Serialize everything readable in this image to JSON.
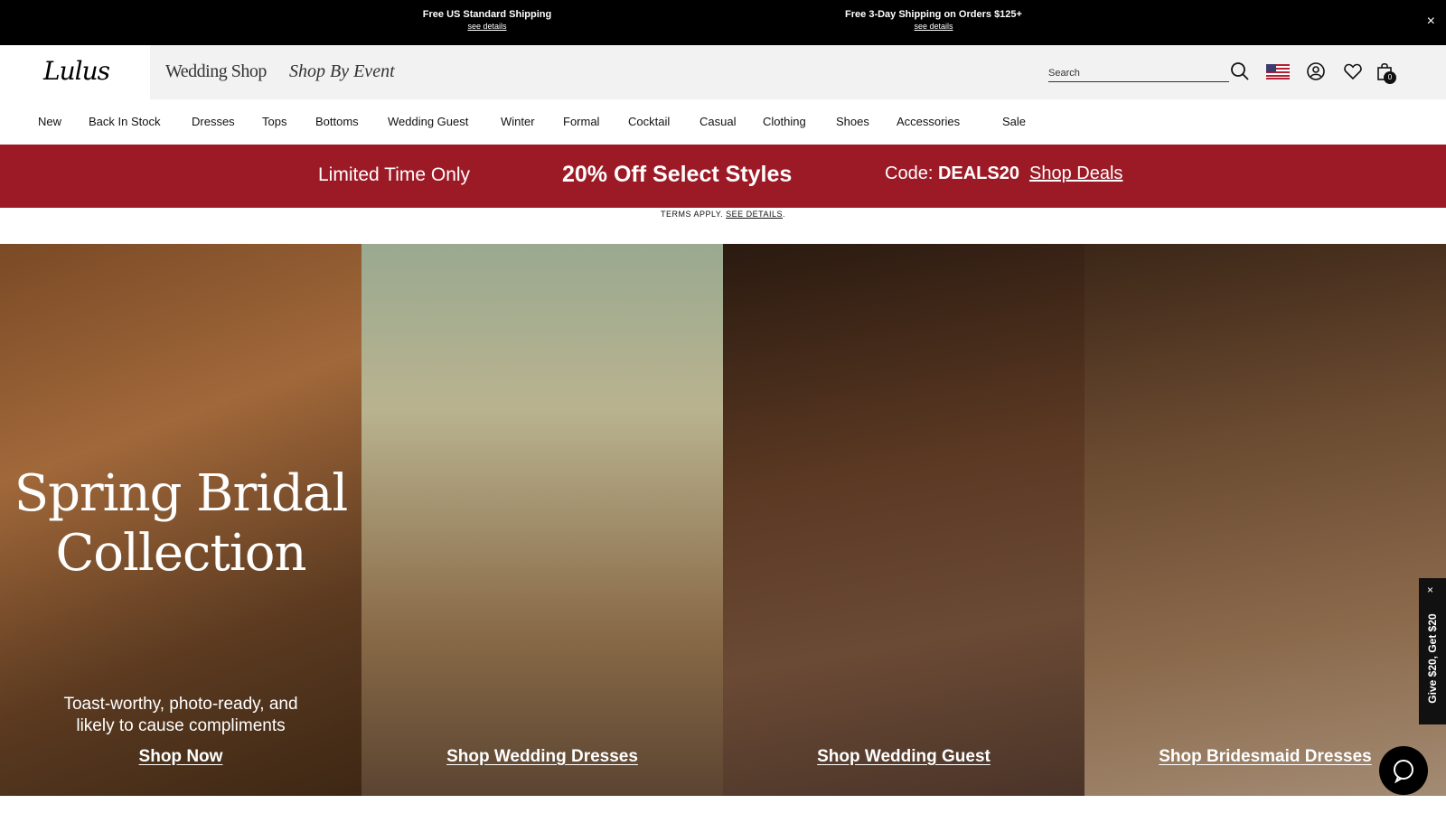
{
  "topbar": {
    "left_title": "Free US Standard Shipping",
    "left_details": "see details",
    "right_title": "Free 3-Day Shipping on Orders $125+",
    "right_details": "see details",
    "close": "×"
  },
  "header": {
    "logo": "Lulus",
    "wedding_shop": "Wedding Shop",
    "shop_by_event": "Shop By Event",
    "search_placeholder": "Search",
    "cart_count": "0"
  },
  "nav": {
    "items": [
      "New",
      "Back In Stock",
      "Dresses",
      "Tops",
      "Bottoms",
      "Wedding Guest",
      "Winter",
      "Formal",
      "Cocktail",
      "Casual",
      "Clothing",
      "Shoes",
      "Accessories",
      "Sale"
    ]
  },
  "promo": {
    "limited": "Limited Time Only",
    "offer": "20% Off Select Styles",
    "code_label": "Code: ",
    "code": "DEALS20",
    "shop_deals": "Shop Deals",
    "terms": "TERMS APPLY.",
    "see_details": "SEE DETAILS"
  },
  "hero": {
    "panel1_heading_line1": "Spring Bridal",
    "panel1_heading_line2": "Collection",
    "panel1_sub_line1": "Toast-worthy, photo-ready, and",
    "panel1_sub_line2": "likely to cause compliments",
    "panel1_cta": "Shop Now",
    "panel2_cta": "Shop Wedding Dresses",
    "panel3_cta": "Shop Wedding Guest",
    "panel4_cta": "Shop Bridesmaid Dresses"
  },
  "sidetab": {
    "text": "Give $20, Get $20",
    "close": "×"
  },
  "colors": {
    "promo_bg": "#9c1a26",
    "topbar_bg": "#000000",
    "header_bg": "#f2f2f2"
  }
}
